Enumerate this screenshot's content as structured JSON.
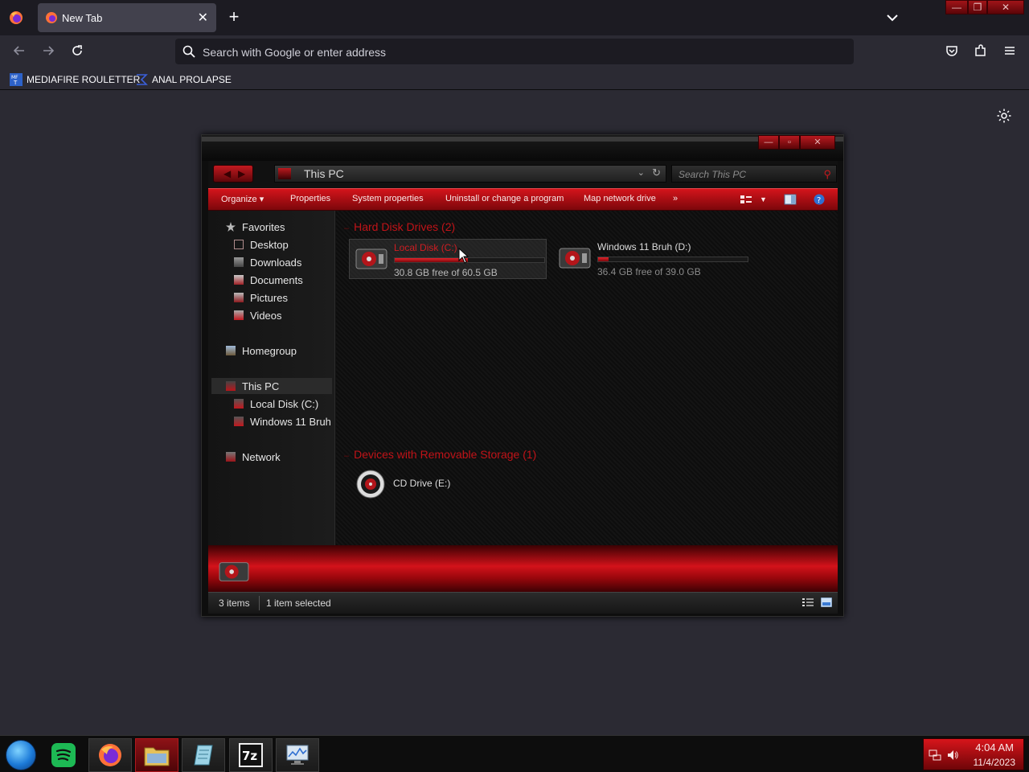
{
  "browser": {
    "tab": {
      "title": "New Tab",
      "close": "✕"
    },
    "new_tab": "+",
    "urlbar": {
      "placeholder": "Search with Google or enter address"
    },
    "bookmarks": [
      {
        "label": "MEDIAFIRE ROULETTER",
        "icon": "mediafire-icon"
      },
      {
        "label": "ANAL PROLAPSE",
        "icon": "sigma-icon"
      }
    ]
  },
  "explorer": {
    "address": "This PC",
    "search_placeholder": "Search This PC",
    "commands": [
      "Organize",
      "Properties",
      "System properties",
      "Uninstall or change a program",
      "Map network drive",
      "»"
    ],
    "nav": {
      "favorites": "Favorites",
      "favorites_items": [
        "Desktop",
        "Downloads",
        "Documents",
        "Pictures",
        "Videos"
      ],
      "homegroup": "Homegroup",
      "this_pc": "This PC",
      "this_pc_items": [
        "Local Disk (C:)",
        "Windows 11 Bruh"
      ],
      "network": "Network"
    },
    "groups": {
      "hdd": "Hard Disk Drives (2)",
      "removable": "Devices with Removable Storage (1)"
    },
    "drives": [
      {
        "name": "Local Disk (C:)",
        "free_text": "30.8 GB free of 60.5 GB",
        "used_fraction": 0.49
      },
      {
        "name": "Windows 11 Bruh (D:)",
        "free_text": "36.4 GB free of 39.0 GB",
        "used_fraction": 0.07
      }
    ],
    "cd": {
      "name": "CD Drive (E:)"
    },
    "status": {
      "items": "3 items",
      "selected": "1 item selected"
    }
  },
  "taskbar": {
    "clock_time": "4:04 AM",
    "clock_date": "11/4/2023",
    "seven_zip_label": "7z"
  },
  "colors": {
    "accent": "#d3121a",
    "chrome_dark": "#1c1b22",
    "page_bg": "#2b2a33"
  }
}
